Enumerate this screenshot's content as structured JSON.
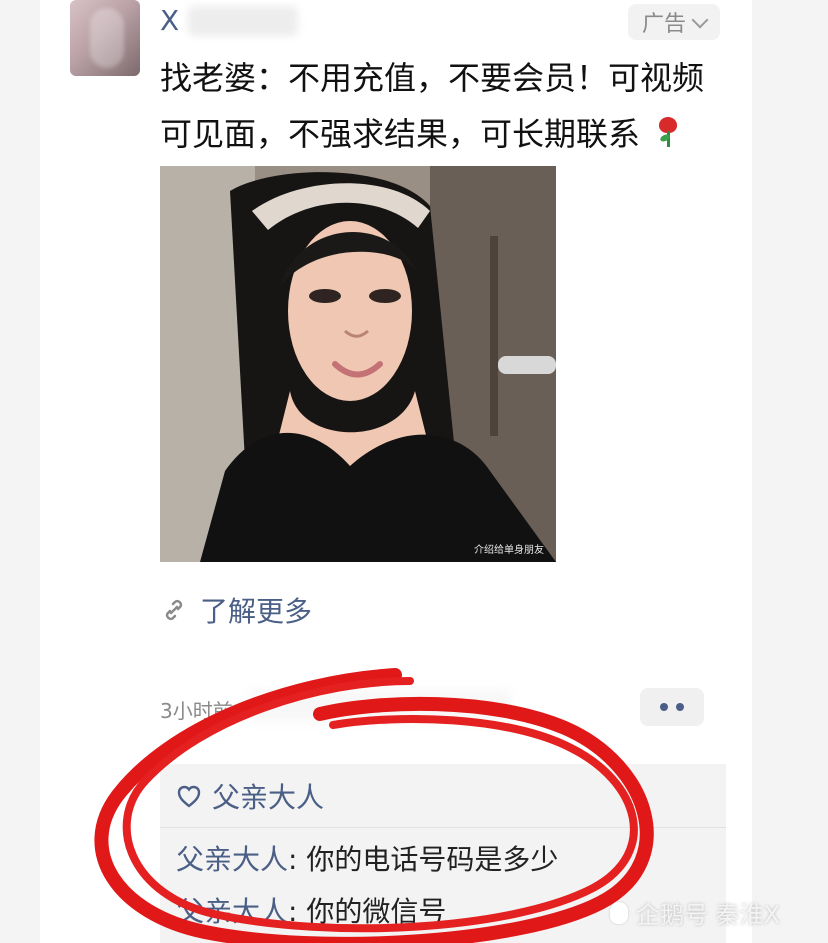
{
  "post": {
    "username_visible": "X",
    "ad_label": "广告",
    "text_line_1": "找老婆：不用充值，不要会员！可视频",
    "text_line_2": "可见面，不强求结果，可长期联系",
    "photo_caption": "介绍给单身朋友",
    "learn_more": "了解更多",
    "time": "3小时前"
  },
  "interactions": {
    "like_name": "父亲大人",
    "comments": [
      {
        "author": "父亲大人",
        "text": "你的电话号码是多少"
      },
      {
        "author": "父亲大人",
        "text": "你的微信号"
      }
    ]
  },
  "watermark": {
    "text": "企鹅号 秦淮X"
  },
  "colors": {
    "link_blue": "#4b5f86",
    "annotation_red": "#e01818",
    "panel_gray": "#f3f3f3"
  },
  "icons": {
    "chevron": "chevron-down-icon",
    "rose": "rose-icon",
    "link": "link-icon",
    "heart": "heart-icon",
    "more": "more-icon",
    "watermark": "penguin-icon"
  }
}
